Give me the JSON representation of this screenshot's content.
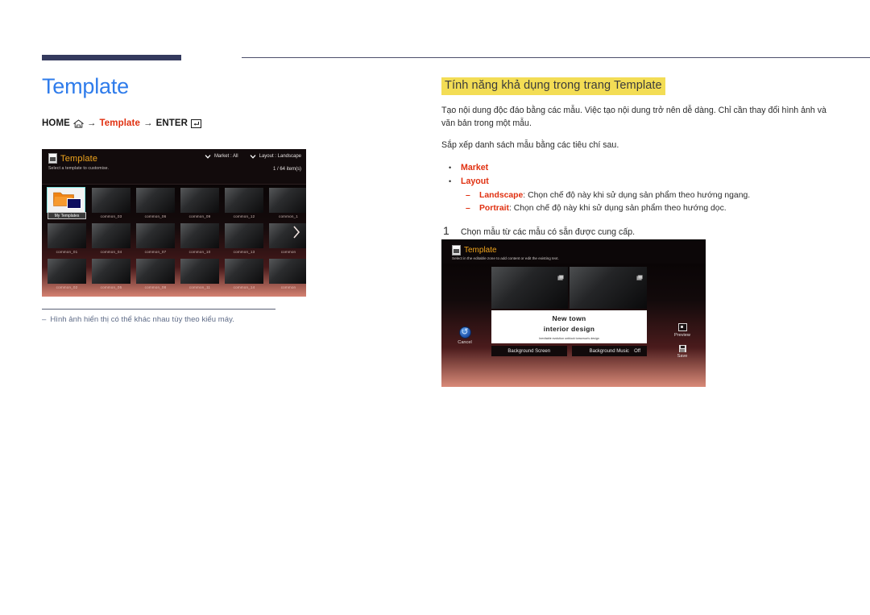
{
  "page": {
    "title": "Template",
    "breadcrumb": {
      "home": "HOME",
      "arrow1": "→",
      "template": "Template",
      "arrow2": "→",
      "enter": "ENTER",
      "home_icon": "home-icon",
      "enter_icon": "enter-key-icon"
    },
    "note": {
      "dash": "–",
      "text": "Hình ảnh hiển thị có thể khác nhau tùy theo kiểu máy."
    }
  },
  "colors": {
    "title_blue": "#2f7ceb",
    "accent_red": "#e03010",
    "highlight_yellow": "#f3dd55",
    "rule_navy": "#343a5e",
    "ui_orange": "#f1a51d",
    "selection_cyan": "#7fe3e0"
  },
  "right": {
    "section_title": "Tính năng khả dụng trong trang Template",
    "paragraph1": "Tạo nội dung độc đáo bằng các mẫu. Việc tạo nội dung trở nên dễ dàng. Chỉ cần thay đổi hình ảnh và văn bản trong một mẫu.",
    "paragraph2": "Sắp xếp danh sách mẫu bằng các tiêu chí sau.",
    "bullets": [
      {
        "label": "Market",
        "sub": []
      },
      {
        "label": "Layout",
        "sub": [
          {
            "label": "Landscape",
            "sep": ": ",
            "text": "Chọn chế độ này khi sử dụng sản phẩm theo hướng ngang."
          },
          {
            "label": "Portrait",
            "sep": ": ",
            "text": "Chọn chế độ này khi sử dụng sản phẩm theo hướng dọc."
          }
        ]
      }
    ],
    "step": {
      "number": "1",
      "text": "Chọn mẫu từ các mẫu có sẵn được cung cấp."
    }
  },
  "gallery_shot": {
    "app_icon": "template-app-icon",
    "title": "Template",
    "subtitle": "Select a template to customise.",
    "filters": [
      {
        "icon": "chevron-down-icon",
        "label": "Market : All"
      },
      {
        "icon": "chevron-down-icon",
        "label": "Layout : Landscape"
      }
    ],
    "count": "1 / 64 item(s)",
    "next_icon": "chevron-right-icon",
    "thumbs": [
      {
        "label": "My Templates",
        "selected": true,
        "row": 1
      },
      {
        "label": "common_03",
        "selected": false,
        "row": 1
      },
      {
        "label": "common_06",
        "selected": false,
        "row": 1
      },
      {
        "label": "common_09",
        "selected": false,
        "row": 1
      },
      {
        "label": "common_12",
        "selected": false,
        "row": 1
      },
      {
        "label": "common_1",
        "selected": false,
        "row": 1
      },
      {
        "label": "common_01",
        "selected": false,
        "row": 2
      },
      {
        "label": "common_04",
        "selected": false,
        "row": 2
      },
      {
        "label": "common_07",
        "selected": false,
        "row": 2
      },
      {
        "label": "common_10",
        "selected": false,
        "row": 2
      },
      {
        "label": "common_13",
        "selected": false,
        "row": 2
      },
      {
        "label": "common",
        "selected": false,
        "row": 2
      },
      {
        "label": "common_02",
        "selected": false,
        "row": 3
      },
      {
        "label": "common_05",
        "selected": false,
        "row": 3
      },
      {
        "label": "common_08",
        "selected": false,
        "row": 3
      },
      {
        "label": "common_11",
        "selected": false,
        "row": 3
      },
      {
        "label": "common_14",
        "selected": false,
        "row": 3
      },
      {
        "label": "common",
        "selected": false,
        "row": 3
      }
    ]
  },
  "editor_shot": {
    "app_icon": "template-app-icon",
    "title": "Template",
    "subtitle": "Select in the editable zone to add content or edit the existing text.",
    "zone_icon": "image-placeholder-icon",
    "text_zone": {
      "line1": "New town",
      "line2": "interior design",
      "line3": "Inevitable evolution unblock tomorrow's design"
    },
    "bottom_buttons": [
      {
        "label": "Background Screen",
        "value": ""
      },
      {
        "label": "Background Music",
        "value": "Off"
      }
    ],
    "left_actions": [
      {
        "icon": "cancel-icon",
        "label": "Cancel"
      }
    ],
    "right_actions": [
      {
        "icon": "preview-icon",
        "label": "Preview"
      },
      {
        "icon": "save-icon",
        "label": "Save"
      }
    ]
  }
}
